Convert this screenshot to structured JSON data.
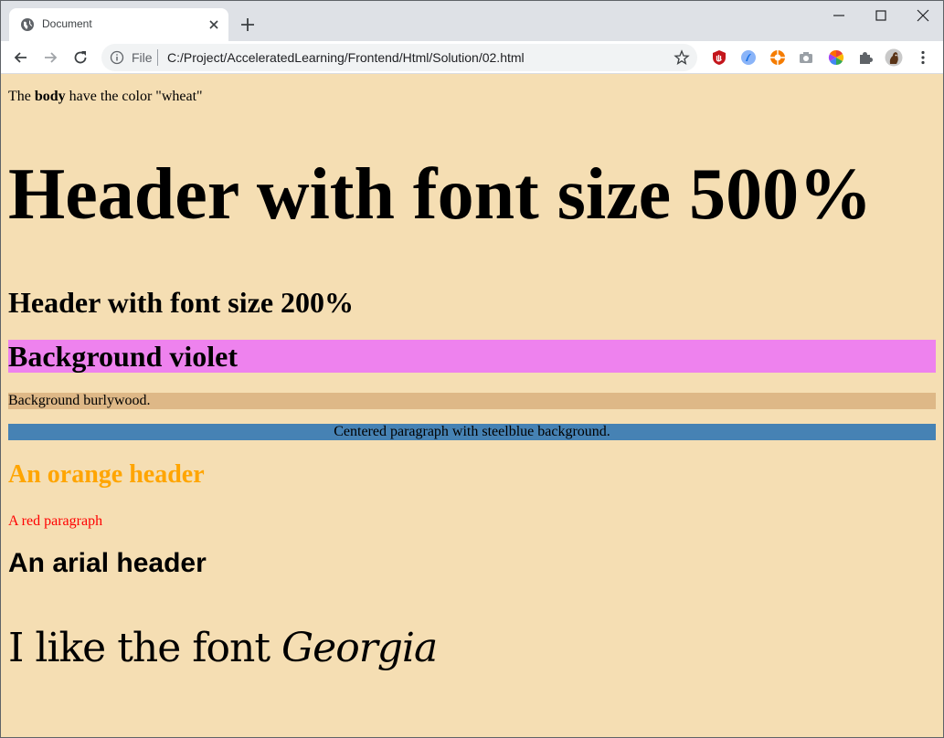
{
  "browser": {
    "tab_title": "Document",
    "omnibox": {
      "scheme_label": "File",
      "url": "C:/Project/AcceleratedLearning/Frontend/Html/Solution/02.html"
    },
    "icons": {
      "favicon": "globe-icon",
      "tab_close": "close-icon",
      "new_tab": "plus-icon",
      "minimize": "minimize-icon",
      "maximize": "maximize-icon",
      "close_window": "close-icon",
      "back": "back-arrow-icon",
      "forward": "forward-arrow-icon",
      "reload": "reload-icon",
      "info": "info-icon",
      "bookmark": "star-icon",
      "extensions": [
        "ublock-icon",
        "blue-extension-icon",
        "orange-extension-icon",
        "camera-icon",
        "color-wheel-icon",
        "puzzle-icon",
        "profile-avatar-icon",
        "kebab-menu-icon"
      ]
    },
    "colors": {
      "tabstrip": "#dee1e6",
      "toolbar": "#ffffff",
      "omnibox": "#f1f3f4"
    }
  },
  "page": {
    "body_note_prefix": "The ",
    "body_note_bold": "body",
    "body_note_suffix": " have the color \"wheat\"",
    "header_500": "Header with font size 500%",
    "header_200": "Header with font size 200%",
    "violet_header": "Background violet",
    "burlywood_paragraph": "Background burlywood.",
    "steelblue_paragraph": "Centered paragraph with steelblue background.",
    "orange_header": "An orange header",
    "red_paragraph": "A red paragraph",
    "arial_header": "An arial header",
    "georgia_prefix": "I like the font ",
    "georgia_italic": "Georgia",
    "colors": {
      "body_background": "#f5deb3",
      "violet": "#ee82ee",
      "burlywood": "#deb887",
      "steelblue": "#4682b4",
      "orange": "#ffa500",
      "red": "#ff0000"
    }
  }
}
